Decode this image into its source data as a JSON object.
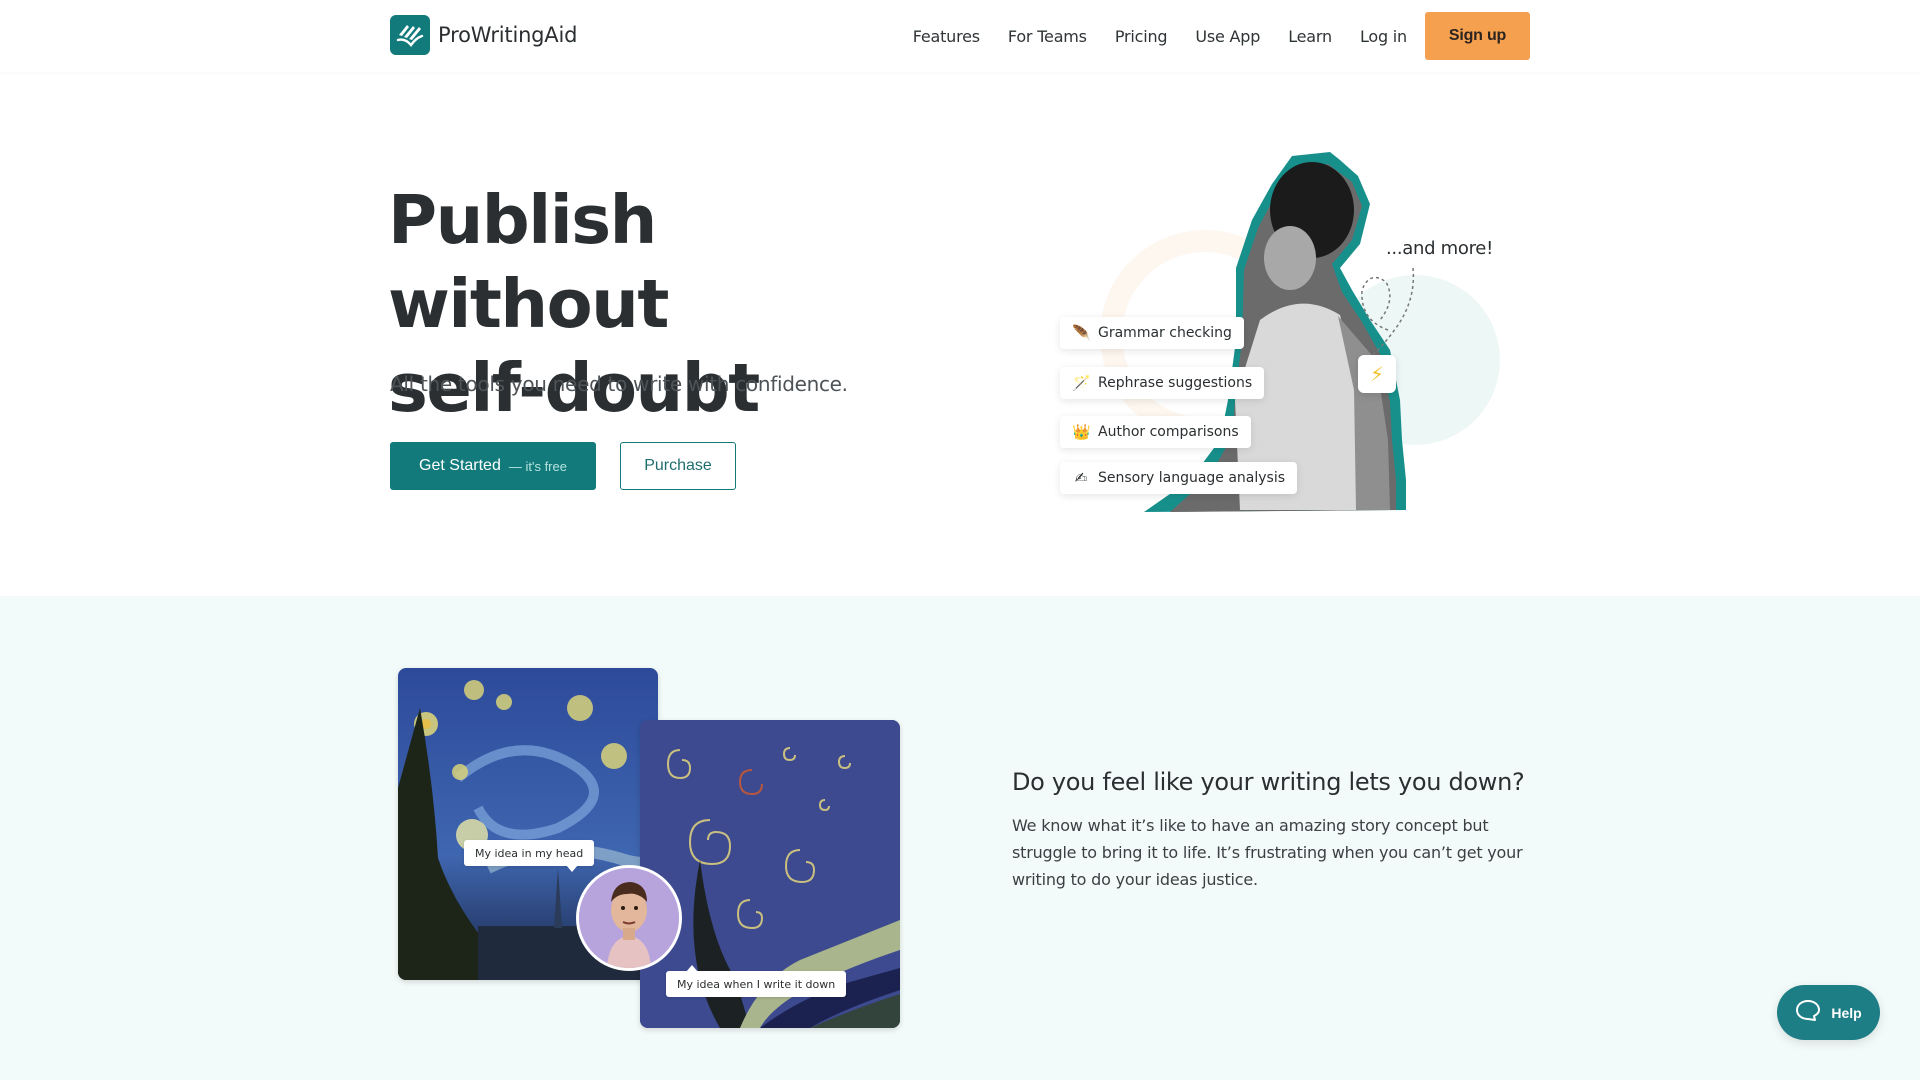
{
  "header": {
    "brand": "ProWritingAid",
    "nav": [
      {
        "label": "Features"
      },
      {
        "label": "For Teams"
      },
      {
        "label": "Pricing"
      },
      {
        "label": "Use App"
      },
      {
        "label": "Learn"
      },
      {
        "label": "Log in"
      }
    ],
    "signup_label": "Sign up"
  },
  "hero": {
    "title_line1": "Publish without",
    "title_line2": "self-doubt",
    "subtitle": "All the tools you need to write with confidence.",
    "primary_label": "Get Started",
    "primary_note": "— it's free",
    "secondary_label": "Purchase",
    "features": [
      {
        "icon": "feather-icon",
        "glyph": "🪶",
        "label": "Grammar checking"
      },
      {
        "icon": "magic-wand-icon",
        "glyph": "🪄",
        "label": "Rephrase suggestions"
      },
      {
        "icon": "crown-icon",
        "glyph": "👑",
        "label": "Author comparisons"
      },
      {
        "icon": "writing-hand-icon",
        "glyph": "✍",
        "label": "Sensory language analysis"
      }
    ],
    "and_more": "...and more!",
    "bolt_glyph": "⚡"
  },
  "section": {
    "bubble_head": "My idea in my head",
    "bubble_down": "My idea when I write it down",
    "title": "Do you feel like your writing lets you down?",
    "body": "We know what it’s like to have an amazing story concept but struggle to bring it to life. It’s frustrating when you can’t get your writing to do your ideas justice."
  },
  "help": {
    "label": "Help"
  },
  "colors": {
    "brand_teal": "#127a7a",
    "signup_orange": "#f5a04e",
    "band_bg": "#f3fbfa",
    "help_teal": "#1e7e85"
  }
}
